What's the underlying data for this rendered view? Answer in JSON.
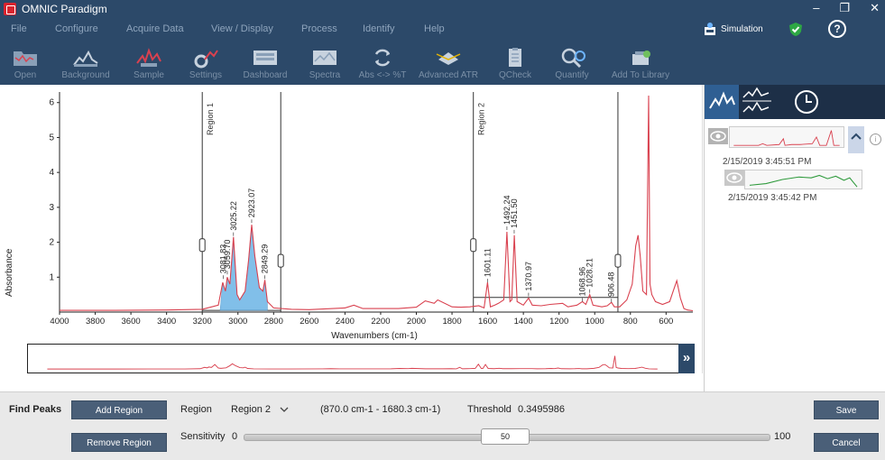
{
  "app": {
    "title": "OMNIC Paradigm"
  },
  "menu": [
    "File",
    "Configure",
    "Acquire Data",
    "View / Display",
    "Process",
    "Identify",
    "Help"
  ],
  "status": {
    "mode_label": "Simulation"
  },
  "toolbar": {
    "open": "Open",
    "background": "Background",
    "sample": "Sample",
    "settings": "Settings",
    "dashboard": "Dashboard",
    "spectra": "Spectra",
    "abs_t": "Abs <-> %T",
    "advanced_atr": "Advanced ATR",
    "qcheck": "QCheck",
    "quantify": "Quantify",
    "add_to_library": "Add To Library"
  },
  "colors": {
    "chrome": "#2c4969",
    "spectrum": "#d9414f",
    "peak_fill": "#6cb4e6",
    "accent_tab": "#2f5f93",
    "green_trace": "#2e9a3c"
  },
  "chart_data": {
    "type": "line",
    "xlabel": "Wavenumbers (cm-1)",
    "ylabel": "Absorbance",
    "xlim": [
      4000,
      450
    ],
    "x_reversed": true,
    "ylim": [
      0,
      6.2
    ],
    "xticks": [
      4000,
      3800,
      3600,
      3400,
      3200,
      3000,
      2800,
      2600,
      2400,
      2200,
      2000,
      1800,
      1600,
      1400,
      1200,
      1000,
      800,
      600
    ],
    "yticks": [
      1,
      2,
      3,
      4,
      5,
      6
    ],
    "regions": [
      {
        "label": "Region 1",
        "from": 3200,
        "to": 2760
      },
      {
        "label": "Region 2",
        "from": 1680.3,
        "to": 870.0
      }
    ],
    "peaks": [
      {
        "x": 3081.83,
        "y": 0.95,
        "label": "3081.83"
      },
      {
        "x": 3059.7,
        "y": 1.08,
        "label": "3059.70"
      },
      {
        "x": 3025.22,
        "y": 2.18,
        "label": "3025.22"
      },
      {
        "x": 2923.07,
        "y": 2.55,
        "label": "2923.07"
      },
      {
        "x": 2849.29,
        "y": 0.95,
        "label": "2849.29"
      },
      {
        "x": 1601.11,
        "y": 0.85,
        "label": "1601.11"
      },
      {
        "x": 1492.24,
        "y": 2.35,
        "label": "1492.24"
      },
      {
        "x": 1451.5,
        "y": 2.25,
        "label": "1451.50"
      },
      {
        "x": 1370.97,
        "y": 0.45,
        "label": "1370.97"
      },
      {
        "x": 1068.96,
        "y": 0.3,
        "label": "1068.96"
      },
      {
        "x": 1028.21,
        "y": 0.55,
        "label": "1028.21"
      },
      {
        "x": 906.48,
        "y": 0.28,
        "label": "906.48"
      }
    ],
    "series": [
      {
        "x": [
          4000,
          3700,
          3400,
          3200,
          3110,
          3085,
          3070,
          3060,
          3045,
          3025,
          3005,
          2990,
          2960,
          2940,
          2923,
          2905,
          2880,
          2860,
          2849,
          2835,
          2800,
          2700,
          2600,
          2400,
          2350,
          2300,
          2100,
          2000,
          1950,
          1900,
          1880,
          1800,
          1750,
          1700,
          1650,
          1620,
          1601,
          1585,
          1560,
          1540,
          1510,
          1492,
          1475,
          1465,
          1451,
          1435,
          1400,
          1371,
          1350,
          1300,
          1250,
          1180,
          1150,
          1100,
          1069,
          1050,
          1028,
          1010,
          960,
          930,
          906,
          890,
          860,
          820,
          790,
          770,
          757,
          745,
          730,
          710,
          698,
          690,
          680,
          660,
          620,
          580,
          560,
          540,
          520,
          500,
          480,
          450
        ],
        "y": [
          0.05,
          0.05,
          0.06,
          0.08,
          0.2,
          0.85,
          0.6,
          1.0,
          0.8,
          2.15,
          0.5,
          0.35,
          0.6,
          1.5,
          2.5,
          1.6,
          0.7,
          0.6,
          0.92,
          0.3,
          0.12,
          0.08,
          0.07,
          0.12,
          0.2,
          0.1,
          0.1,
          0.14,
          0.32,
          0.25,
          0.35,
          0.15,
          0.14,
          0.15,
          0.18,
          0.12,
          0.85,
          0.15,
          0.2,
          0.25,
          0.35,
          2.3,
          0.3,
          0.35,
          2.2,
          0.3,
          0.2,
          0.4,
          0.2,
          0.18,
          0.22,
          0.25,
          0.15,
          0.2,
          0.3,
          0.22,
          0.5,
          0.2,
          0.15,
          0.18,
          0.28,
          0.15,
          0.15,
          0.35,
          0.8,
          1.9,
          2.2,
          1.6,
          0.6,
          0.5,
          6.2,
          0.8,
          0.5,
          0.3,
          0.22,
          0.3,
          0.6,
          0.9,
          0.4,
          0.1,
          0.06,
          0.04
        ]
      }
    ]
  },
  "right_panel": {
    "spectra": [
      {
        "timestamp": "2/15/2019 3:45:51 PM"
      },
      {
        "timestamp": "2/15/2019 3:45:42 PM"
      }
    ]
  },
  "find_peaks": {
    "title": "Find Peaks",
    "add_region": "Add Region",
    "remove_region": "Remove Region",
    "region_label": "Region",
    "region_value": "Region 2",
    "range_text": "(870.0 cm-1 - 1680.3 cm-1)",
    "threshold_label": "Threshold",
    "threshold_value": "0.3495986",
    "sensitivity_label": "Sensitivity",
    "sensitivity_min": "0",
    "sensitivity_max": "100",
    "sensitivity_value": "50",
    "save": "Save",
    "cancel": "Cancel"
  }
}
